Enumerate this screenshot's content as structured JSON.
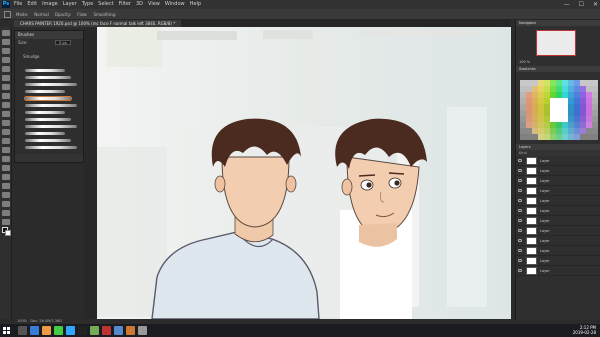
{
  "app": {
    "logo": "Ps",
    "menu": [
      "File",
      "Edit",
      "Image",
      "Layer",
      "Type",
      "Select",
      "Filter",
      "3D",
      "View",
      "Window",
      "Help"
    ],
    "window_controls": [
      "—",
      "☐",
      "✕"
    ]
  },
  "options_bar": [
    "Mode:",
    "Normal",
    "Opacity:",
    "Flow:",
    "Smoothing:"
  ],
  "document": {
    "tab_title": "CHARS PAINTER 1920.psd @ 100% (mc face F normal talk left 3840, RGB/8) *"
  },
  "brushes": {
    "panel_title": "Brushes",
    "size_label": "Size:",
    "size_value": "5 px",
    "folder": "Smudge",
    "strokes": 12
  },
  "canvas_ui": {
    "btn1": "",
    "btn2": ""
  },
  "status": {
    "zoom": "100%",
    "doc": "Doc: 26.4M/2.36G"
  },
  "navigator": {
    "title": "Navigator",
    "zoom": "100 %"
  },
  "swatches": {
    "title": "Swatches"
  },
  "layers": {
    "title": "Layers",
    "tabs": [
      "Layers",
      "Channels",
      "Paths"
    ],
    "filter": "Kind",
    "items": [
      "Layer",
      "Layer",
      "Layer",
      "Layer",
      "Layer",
      "Layer",
      "Layer",
      "Layer",
      "Layer",
      "Layer",
      "Layer",
      "Layer"
    ]
  },
  "taskbar": {
    "time": "2:12 PM",
    "date": "2019-02-28"
  },
  "colors": {
    "accent": "#31a8ff",
    "skin": "#f2cdb0",
    "hair": "#4b2b1f",
    "shirt": "#dfe8f0"
  }
}
